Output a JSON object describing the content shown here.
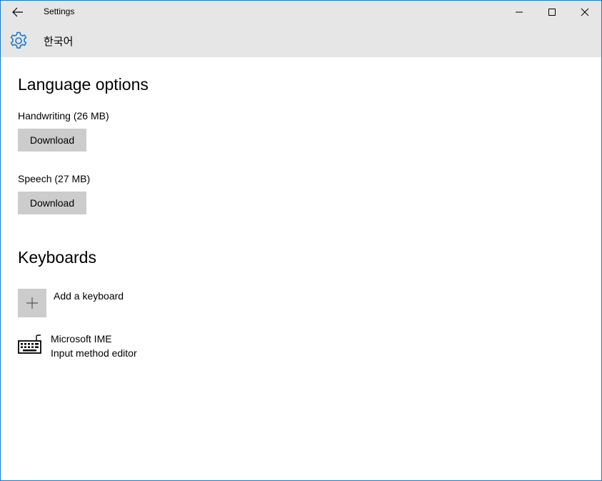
{
  "window": {
    "title": "Settings",
    "controls": [
      "minimize-icon",
      "maximize-icon",
      "close-icon"
    ]
  },
  "header": {
    "icon": "gear-icon",
    "title": "한국어"
  },
  "language_options": {
    "heading": "Language options",
    "handwriting_label": "Handwriting (26 MB)",
    "handwriting_button": "Download",
    "speech_label": "Speech (27 MB)",
    "speech_button": "Download"
  },
  "keyboards": {
    "heading": "Keyboards",
    "add_label": "Add a keyboard",
    "items": [
      {
        "name": "Microsoft IME",
        "description": "Input method editor",
        "icon": "keyboard-icon"
      }
    ]
  },
  "colors": {
    "accent": "#1979ca",
    "chrome": "#e6e6e6",
    "button": "#cccccc"
  }
}
